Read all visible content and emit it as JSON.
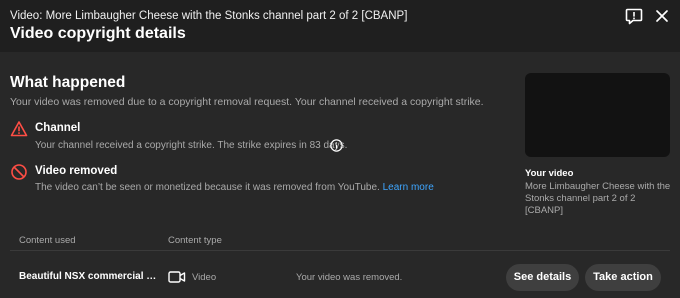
{
  "header": {
    "video_label": "Video: More Limbaugher Cheese with the Stonks channel part 2 of 2 [CBANP]",
    "title": "Video copyright details",
    "icons": {
      "feedback": "feedback-icon",
      "close": "close-icon"
    }
  },
  "what_happened": {
    "title": "What happened",
    "summary": "Your video was removed due to a copyright removal request. Your channel received a copyright strike.",
    "items": [
      {
        "icon": "warning-triangle-icon",
        "title": "Channel",
        "description": "Your channel received a copyright strike. The strike expires in 83 days.",
        "trailing_icon": "info-icon"
      },
      {
        "icon": "blocked-circle-icon",
        "title": "Video removed",
        "description": "The video can’t be seen or monetized because it was removed from YouTube.",
        "link": "Learn more"
      }
    ]
  },
  "your_video": {
    "label": "Your video",
    "title": "More Limbaugher Cheese with the Stonks channel part 2 of 2 [CBANP]"
  },
  "table": {
    "headers": [
      "Content used",
      "Content type"
    ],
    "rows": [
      {
        "content": "Beautiful NSX commercial - So...",
        "type_icon": "video-camera-icon",
        "type": "Video",
        "status": "Your video was removed.",
        "actions": [
          "See details",
          "Take action"
        ]
      }
    ]
  },
  "colors": {
    "background": "#282828",
    "header_background": "#1f1f1f",
    "warning_red": "#ff4e45",
    "link_blue": "#3ea6ff",
    "button_background": "#3f3f3f"
  }
}
